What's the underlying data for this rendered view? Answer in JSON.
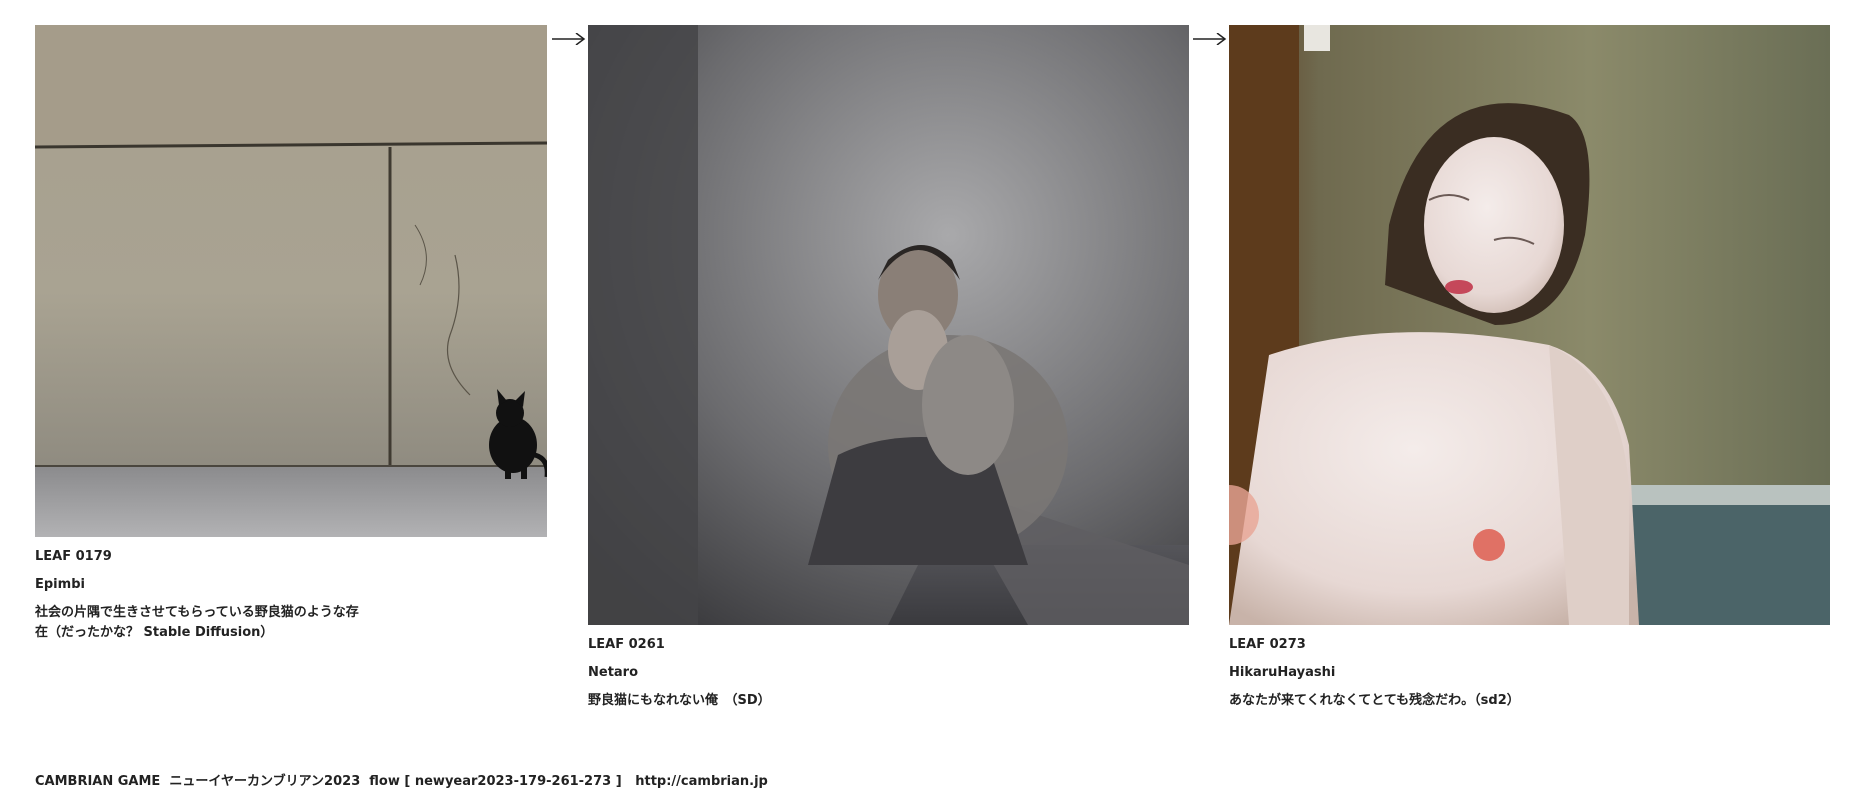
{
  "leaves": [
    {
      "id": "LEAF 0179",
      "author": "Epimbi",
      "caption": "社会の片隅で生きさせてもらっている野良猫のような存在（だったかな？ Stable Diffusion）",
      "image_subject": "black kitten sitting against a concrete wall"
    },
    {
      "id": "LEAF 0261",
      "author": "Netaro",
      "caption": "野良猫にもなれない俺　（SD）",
      "image_subject": "person crouching in a dark room corner covering face"
    },
    {
      "id": "LEAF 0273",
      "author": "HikaruHayashi",
      "caption": "あなたが来てくれなくてとても残念だわ。（sd2）",
      "image_subject": "painted portrait of a woman with eyes closed"
    }
  ],
  "arrows": [
    "arrow-right-icon",
    "arrow-right-icon"
  ],
  "footer": "CAMBRIAN GAME  ニューイヤーカンブリアン2023  flow [ newyear2023-179-261-273 ]   http://cambrian.jp"
}
